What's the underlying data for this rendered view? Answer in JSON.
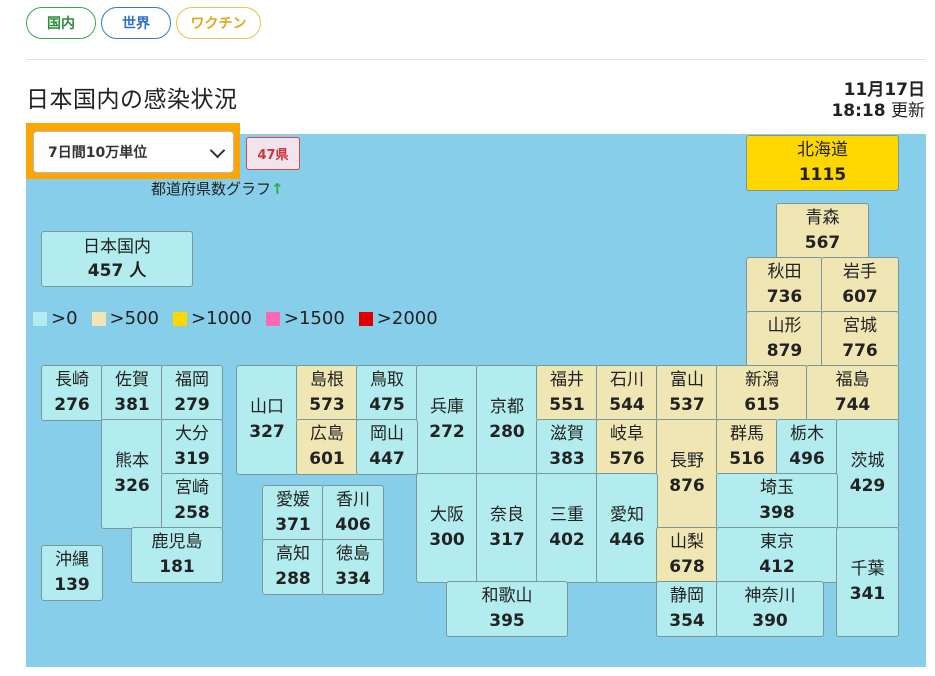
{
  "tabs": {
    "domestic": "国内",
    "world": "世界",
    "vaccine": "ワクチン"
  },
  "header": {
    "title": "日本国内の感染状況",
    "date": "11月17日",
    "time": "18:18",
    "update_label": "更新"
  },
  "controls": {
    "select_value": "7日間10万単位",
    "prefecture_count": "47県",
    "graph_link": "都道府県数グラフ",
    "graph_arrow": "↑"
  },
  "national": {
    "label": "日本国内",
    "value": "457",
    "unit": "人"
  },
  "legend": [
    {
      "label": ">0",
      "color": "#b2ecee"
    },
    {
      "label": ">500",
      "color": "#efe6b4"
    },
    {
      "label": ">1000",
      "color": "#ffd700"
    },
    {
      "label": ">1500",
      "color": "#ff69b4"
    },
    {
      "label": ">2000",
      "color": "#e00000"
    }
  ],
  "prefectures": {
    "hokkaido": {
      "name": "北海道",
      "value": "1115"
    },
    "aomori": {
      "name": "青森",
      "value": "567"
    },
    "akita": {
      "name": "秋田",
      "value": "736"
    },
    "iwate": {
      "name": "岩手",
      "value": "607"
    },
    "yamagata": {
      "name": "山形",
      "value": "879"
    },
    "miyagi": {
      "name": "宮城",
      "value": "776"
    },
    "nagasaki": {
      "name": "長崎",
      "value": "276"
    },
    "saga": {
      "name": "佐賀",
      "value": "381"
    },
    "fukuoka": {
      "name": "福岡",
      "value": "279"
    },
    "yamaguchi": {
      "name": "山口",
      "value": "327"
    },
    "shimane": {
      "name": "島根",
      "value": "573"
    },
    "tottori": {
      "name": "鳥取",
      "value": "475"
    },
    "hyogo": {
      "name": "兵庫",
      "value": "272"
    },
    "kyoto": {
      "name": "京都",
      "value": "280"
    },
    "fukui": {
      "name": "福井",
      "value": "551"
    },
    "ishikawa": {
      "name": "石川",
      "value": "544"
    },
    "toyama": {
      "name": "富山",
      "value": "537"
    },
    "niigata": {
      "name": "新潟",
      "value": "615"
    },
    "fukushima": {
      "name": "福島",
      "value": "744"
    },
    "kumamoto": {
      "name": "熊本",
      "value": "326"
    },
    "oita": {
      "name": "大分",
      "value": "319"
    },
    "hiroshima": {
      "name": "広島",
      "value": "601"
    },
    "okayama": {
      "name": "岡山",
      "value": "447"
    },
    "shiga": {
      "name": "滋賀",
      "value": "383"
    },
    "gifu": {
      "name": "岐阜",
      "value": "576"
    },
    "nagano": {
      "name": "長野",
      "value": "876"
    },
    "gunma": {
      "name": "群馬",
      "value": "516"
    },
    "tochigi": {
      "name": "栃木",
      "value": "496"
    },
    "ibaraki": {
      "name": "茨城",
      "value": "429"
    },
    "miyazaki": {
      "name": "宮崎",
      "value": "258"
    },
    "ehime": {
      "name": "愛媛",
      "value": "371"
    },
    "kagawa": {
      "name": "香川",
      "value": "406"
    },
    "osaka": {
      "name": "大阪",
      "value": "300"
    },
    "nara": {
      "name": "奈良",
      "value": "317"
    },
    "mie": {
      "name": "三重",
      "value": "402"
    },
    "aichi": {
      "name": "愛知",
      "value": "446"
    },
    "saitama": {
      "name": "埼玉",
      "value": "398"
    },
    "okinawa": {
      "name": "沖縄",
      "value": "139"
    },
    "kagoshima": {
      "name": "鹿児島",
      "value": "181"
    },
    "kochi": {
      "name": "高知",
      "value": "288"
    },
    "tokushima": {
      "name": "徳島",
      "value": "334"
    },
    "yamanashi": {
      "name": "山梨",
      "value": "678"
    },
    "tokyo": {
      "name": "東京",
      "value": "412"
    },
    "chiba": {
      "name": "千葉",
      "value": "341"
    },
    "wakayama": {
      "name": "和歌山",
      "value": "395"
    },
    "shizuoka": {
      "name": "静岡",
      "value": "354"
    },
    "kanagawa": {
      "name": "神奈川",
      "value": "390"
    }
  }
}
